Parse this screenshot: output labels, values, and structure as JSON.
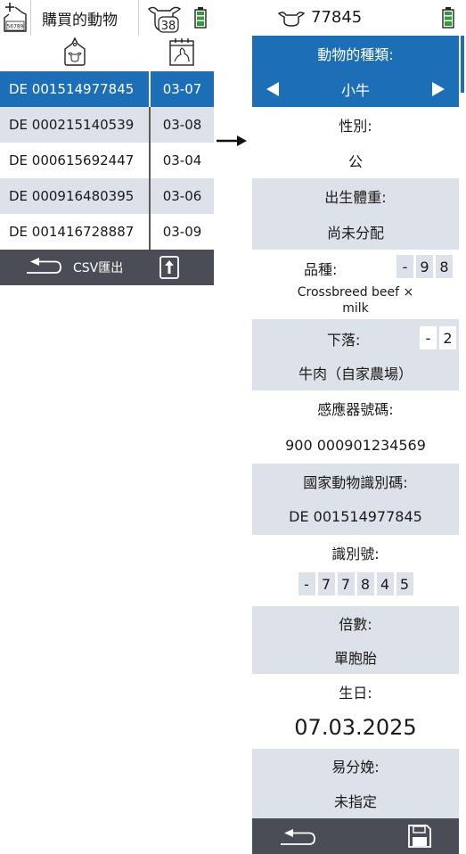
{
  "left_screen": {
    "title": "購買的動物",
    "badge_count": "38",
    "tag_icon_text": "56789",
    "rows": [
      {
        "id": "DE 001514977845",
        "date": "03-07",
        "selected": true
      },
      {
        "id": "DE 000215140539",
        "date": "03-08",
        "selected": false
      },
      {
        "id": "DE 000615692447",
        "date": "03-04",
        "selected": false
      },
      {
        "id": "DE 000916480395",
        "date": "03-06",
        "selected": false
      },
      {
        "id": "DE 001416728887",
        "date": "03-09",
        "selected": false
      }
    ],
    "footer_label": "CSV匯出"
  },
  "right_screen": {
    "header_number": "77845",
    "animal_type_label": "動物的種類:",
    "animal_type_value": "小牛",
    "sex_label": "性別:",
    "sex_value": "公",
    "birth_weight_label": "出生體重:",
    "birth_weight_value": "尚未分配",
    "breed_label": "品種:",
    "breed_digits": [
      "-",
      "9",
      "8"
    ],
    "breed_value_line1": "Crossbreed beef ×",
    "breed_value_line2": "milk",
    "whereabouts_label": "下落:",
    "whereabouts_digits": [
      "-",
      "2"
    ],
    "whereabouts_value": "牛肉（自家農場）",
    "sensor_label": "感應器號碼:",
    "sensor_value": "900 000901234569",
    "national_id_label": "國家動物識別碼:",
    "national_id_value": "DE 001514977845",
    "ident_label": "識別號:",
    "ident_digits": [
      "-",
      "7",
      "7",
      "8",
      "4",
      "5"
    ],
    "multiple_label": "倍數:",
    "multiple_value": "單胞胎",
    "birthday_label": "生日:",
    "birthday_value": "07.03.2025",
    "calving_label": "易分娩:",
    "calving_value": "未指定"
  },
  "colors": {
    "selection_blue": "#1c6eb7",
    "row_grey": "#dde2ea",
    "footer_dark": "#4a4d55",
    "battery_green": "#2e9e3a"
  },
  "icons": {
    "left_header": [
      "tag-add-icon",
      "cow-count-icon",
      "battery-icon"
    ],
    "left_columns": [
      "ear-tag-icon",
      "calendar-calf-icon"
    ],
    "left_footer": [
      "back-icon",
      "upload-icon"
    ],
    "right_header": [
      "cow-head-icon",
      "battery-icon"
    ],
    "right_type": [
      "arrow-left-icon",
      "arrow-right-icon"
    ],
    "right_footer": [
      "back-icon",
      "save-icon"
    ]
  }
}
